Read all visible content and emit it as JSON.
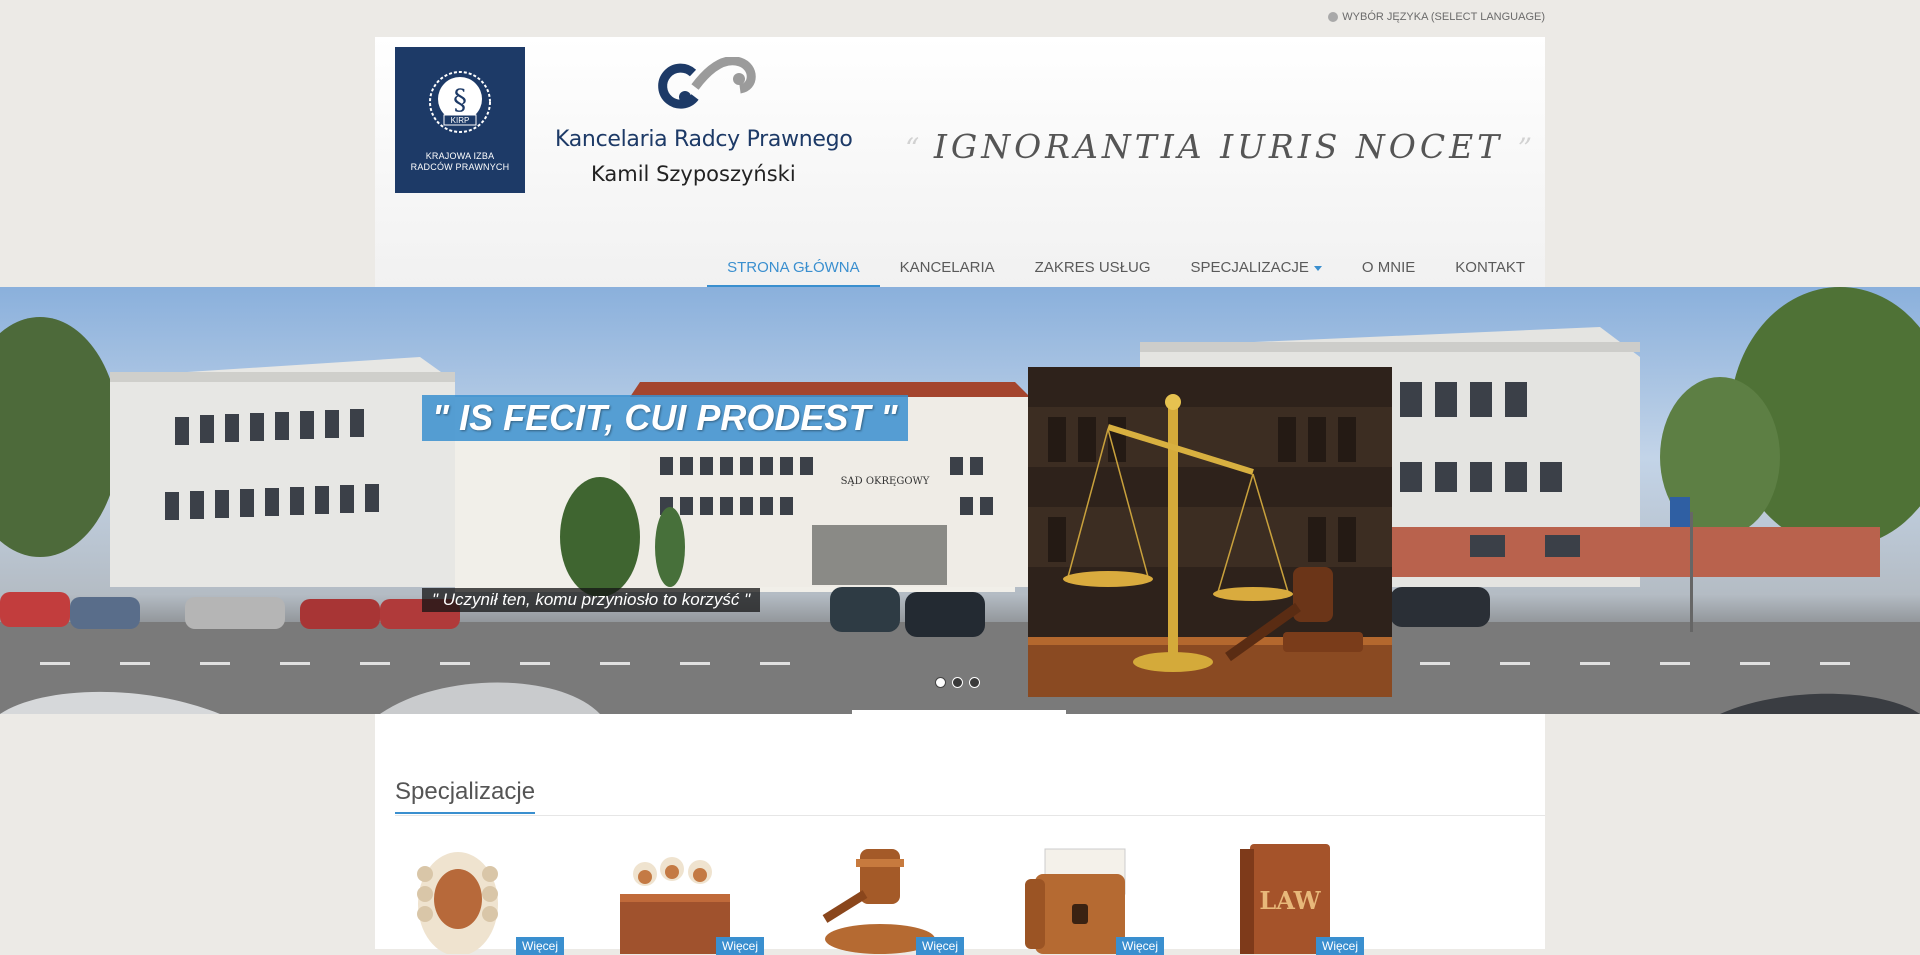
{
  "top": {
    "language_label": "WYBÓR JĘZYKA (SELECT LANGUAGE)"
  },
  "header": {
    "kirp_line1": "KRAJOWA IZBA",
    "kirp_line2": "RADCÓW PRAWNYCH",
    "kirp_badge": "KIRP",
    "firm_name": "Kancelaria Radcy Prawnego",
    "firm_owner": "Kamil Szyposzyński",
    "motto": "IGNORANTIA  IURIS  NOCET",
    "motto_open_quote": "“",
    "motto_close_quote": "”"
  },
  "nav": {
    "items": [
      {
        "label": "STRONA GŁÓWNA",
        "active": true
      },
      {
        "label": "KANCELARIA"
      },
      {
        "label": "ZAKRES USŁUG"
      },
      {
        "label": "SPECJALIZACJE",
        "dropdown": true
      },
      {
        "label": "O MNIE"
      },
      {
        "label": "KONTAKT"
      }
    ]
  },
  "slider": {
    "caption_main": "\" IS FECIT, CUI PRODEST \"",
    "caption_sub": "\" Uczynił ten, komu przyniosło to korzyść \"",
    "building_sign": "SĄD OKRĘGOWY",
    "slide_count": 3,
    "active_slide": 1
  },
  "section": {
    "title": "Specjalizacje",
    "more_label": "Więcej",
    "cards": [
      {
        "icon": "judge-wig-icon"
      },
      {
        "icon": "jury-box-icon"
      },
      {
        "icon": "gavel-icon"
      },
      {
        "icon": "briefcase-documents-icon"
      },
      {
        "icon": "law-book-icon"
      }
    ],
    "book_text": "LAW"
  },
  "colors": {
    "accent": "#3a8fcf",
    "navy": "#1d3a67",
    "background": "#eceae6"
  }
}
